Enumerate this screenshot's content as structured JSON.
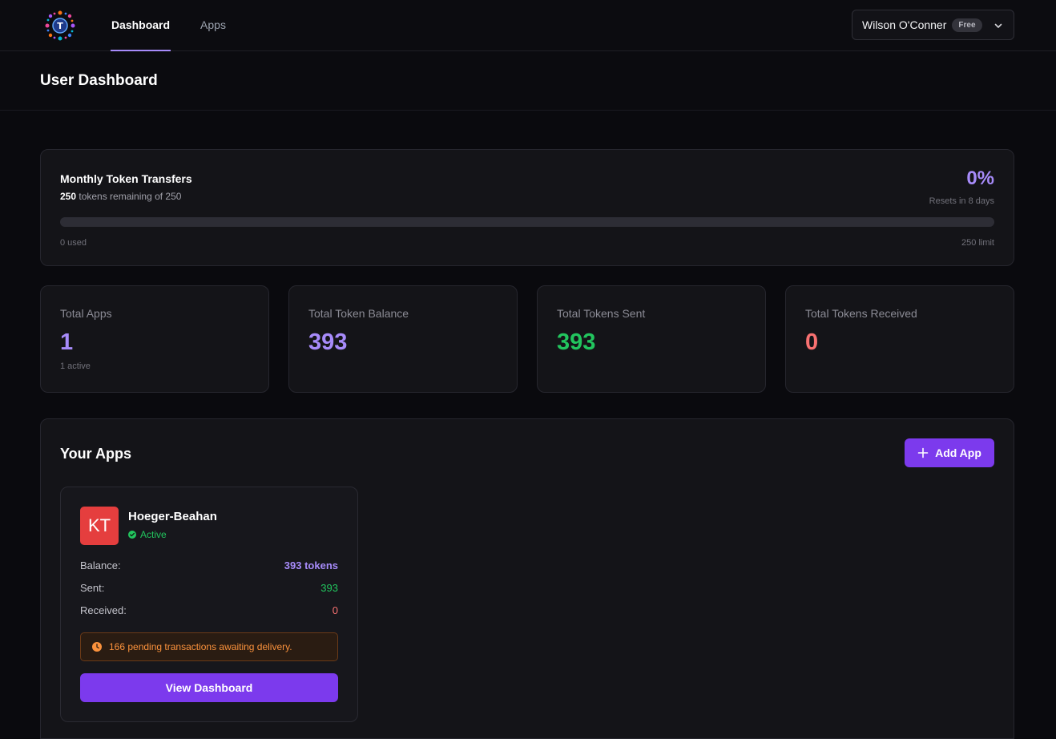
{
  "nav": {
    "tabs": [
      {
        "label": "Dashboard",
        "active": true
      },
      {
        "label": "Apps",
        "active": false
      }
    ],
    "user": {
      "name": "Wilson O'Conner",
      "plan": "Free"
    }
  },
  "header": {
    "title": "User Dashboard"
  },
  "transfers": {
    "title": "Monthly Token Transfers",
    "remaining": "250",
    "remaining_text": " tokens remaining of 250",
    "percent": "0%",
    "progress_fraction": 0,
    "reset_text": "Resets in 8 days",
    "used_text": "0 used",
    "limit_text": "250 limit"
  },
  "stats": [
    {
      "label": "Total Apps",
      "value": "1",
      "sub": "1 active",
      "color": "#a78bfa"
    },
    {
      "label": "Total Token Balance",
      "value": "393",
      "sub": "",
      "color": "#a78bfa"
    },
    {
      "label": "Total Tokens Sent",
      "value": "393",
      "sub": "",
      "color": "#22c55e"
    },
    {
      "label": "Total Tokens Received",
      "value": "0",
      "sub": "",
      "color": "#f87171"
    }
  ],
  "apps": {
    "title": "Your Apps",
    "add_label": "Add App",
    "items": [
      {
        "initials": "KT",
        "name": "Hoeger-Beahan",
        "status": "Active",
        "balance_label": "Balance:",
        "balance": "393 tokens",
        "sent_label": "Sent:",
        "sent": "393",
        "received_label": "Received:",
        "received": "0",
        "pending": "166 pending transactions awaiting delivery.",
        "view_label": "View Dashboard"
      }
    ]
  },
  "colors": {
    "accent": "#7c3aed",
    "accent_light": "#a78bfa",
    "success": "#22c55e",
    "danger": "#f87171",
    "warning": "#fb923c"
  }
}
